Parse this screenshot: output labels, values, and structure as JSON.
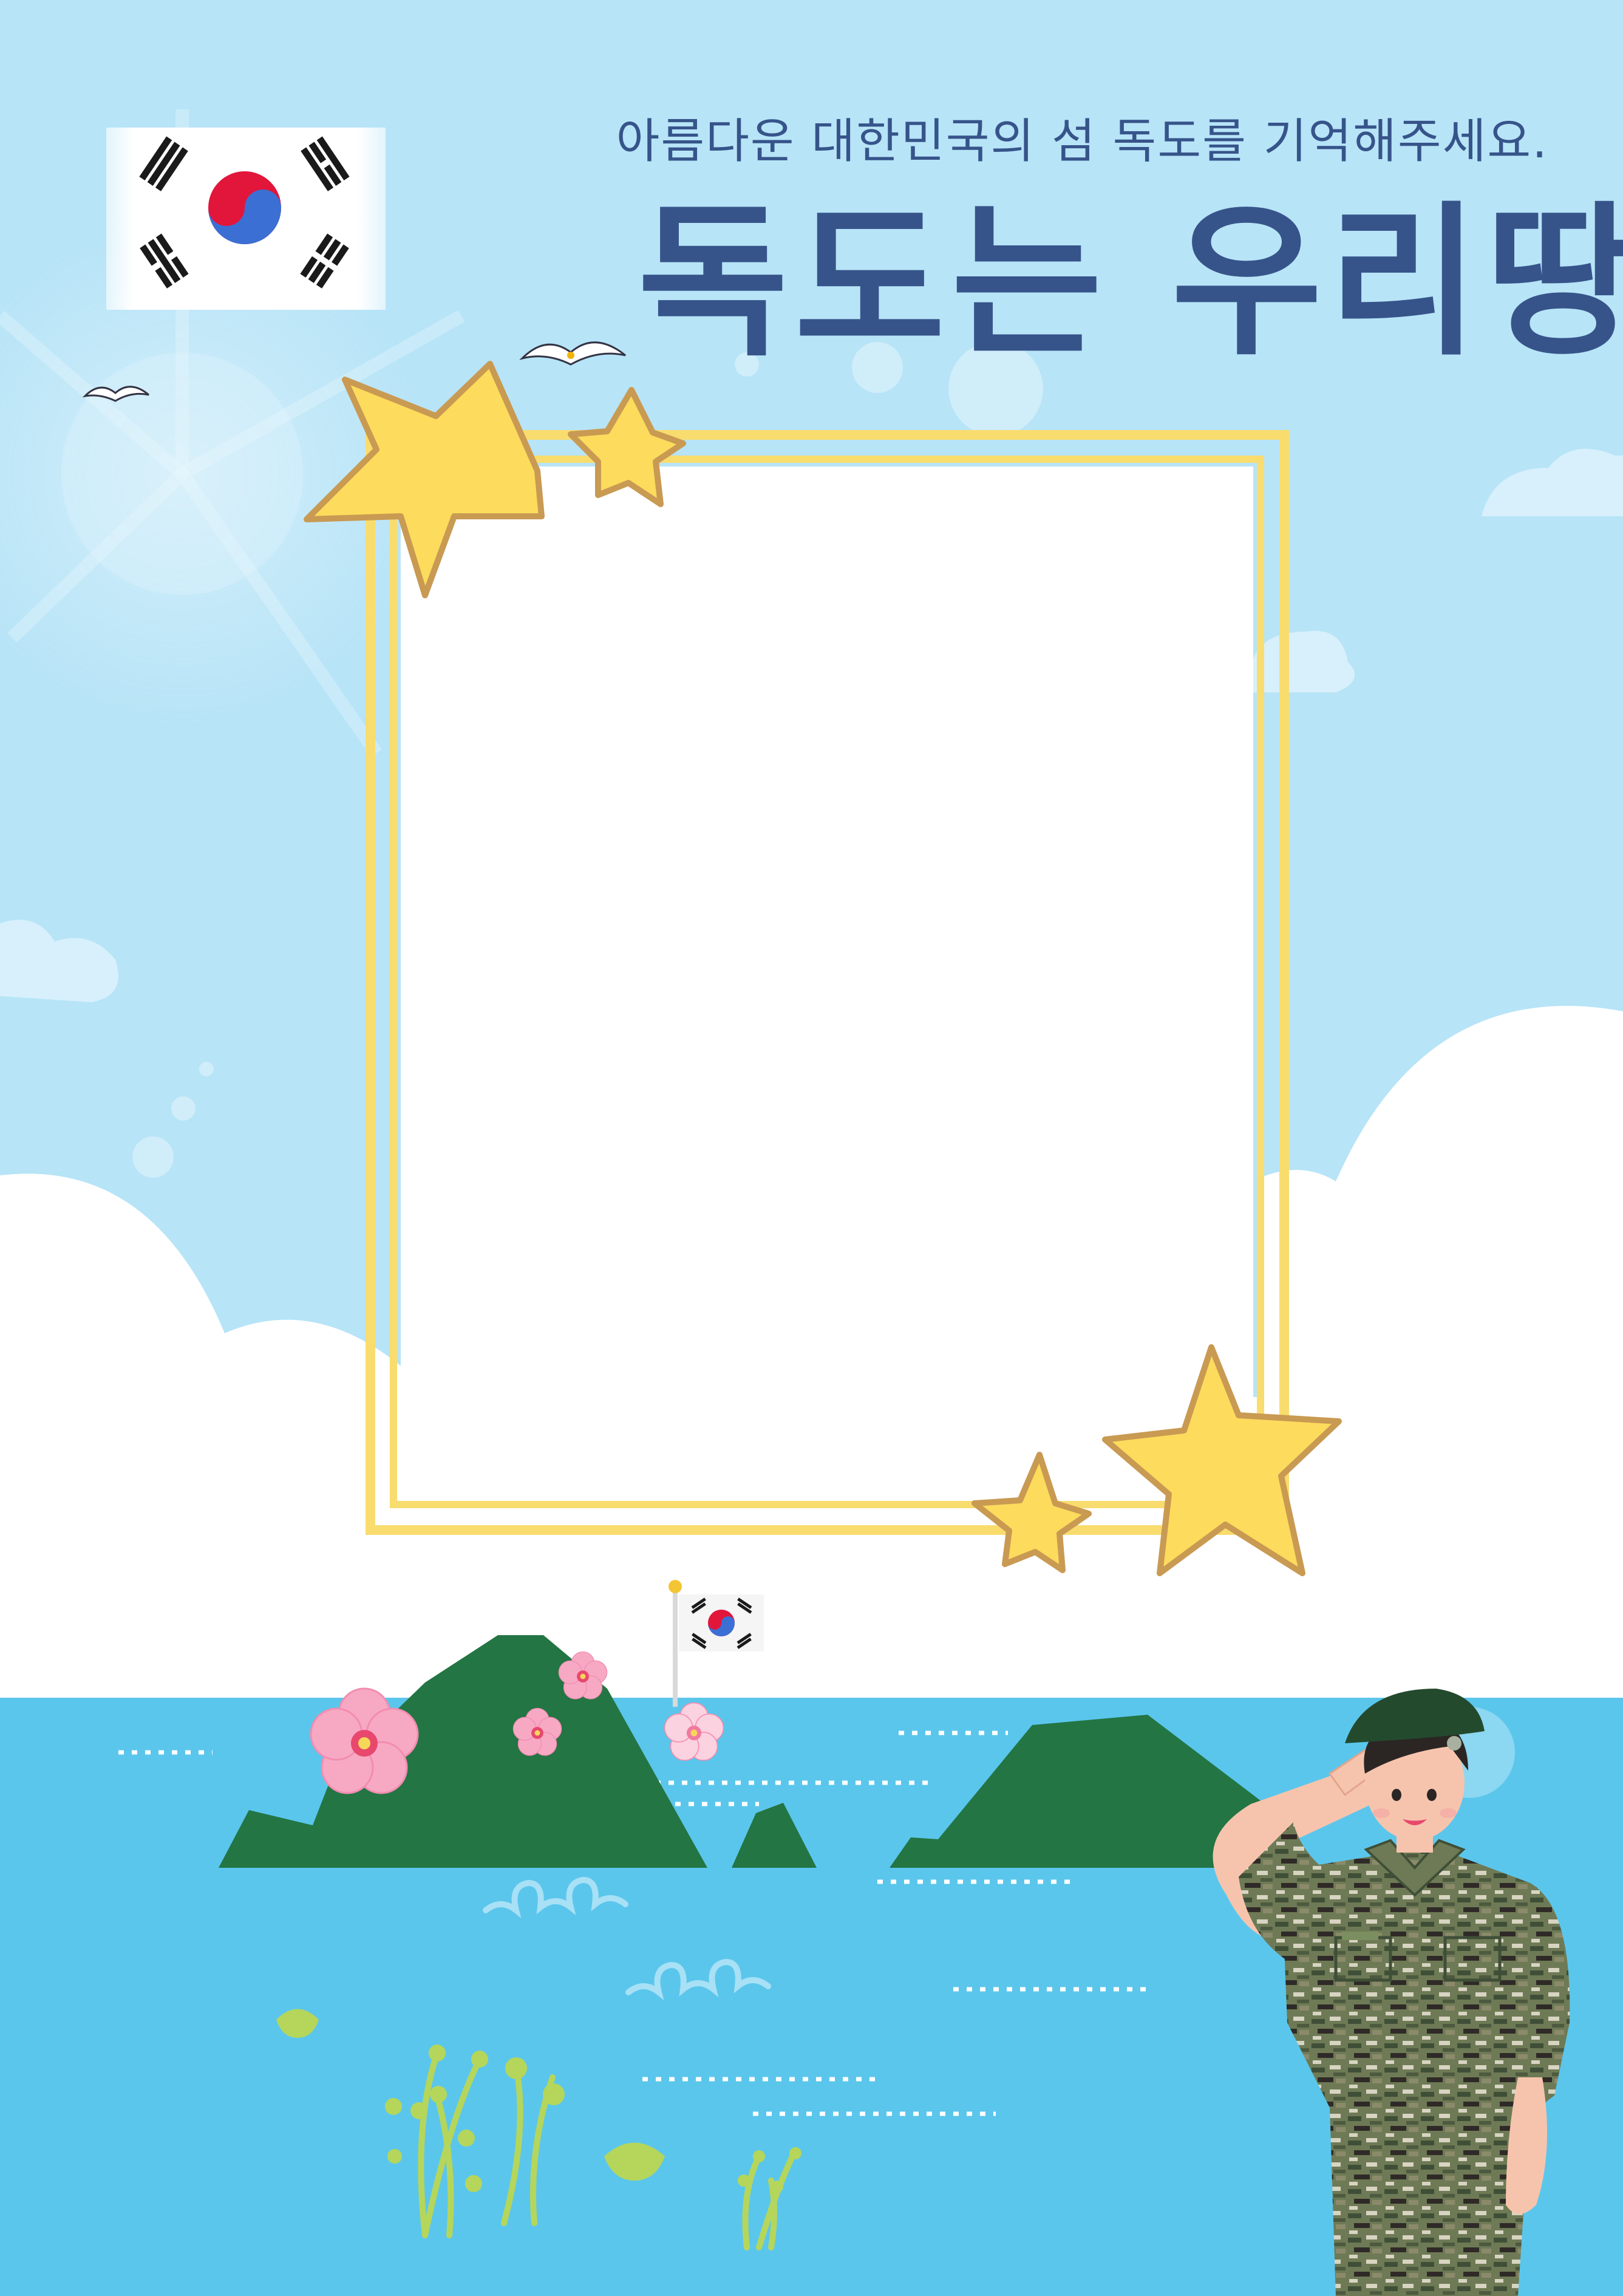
{
  "poster": {
    "subtitle": "아름다운 대한민국의 섬 독도를 기억해주세요.",
    "title": "독도는 우리땅"
  },
  "colors": {
    "sky": "#b7e4f7",
    "sea": "#5bc6ec",
    "island": "#237543",
    "title_text": "#36548a",
    "frame": "#f9dc6e",
    "star_fill": "#fddb5d",
    "star_stroke": "#c99a52",
    "cloud": "#ffffff",
    "flower": "#f7a9c4"
  },
  "icons": {
    "flag": "taegukgi-flag-icon",
    "star": "star-icon",
    "seagull": "seagull-icon",
    "flower": "mugunghwa-flower-icon",
    "soldier": "saluting-soldier-illustration"
  }
}
